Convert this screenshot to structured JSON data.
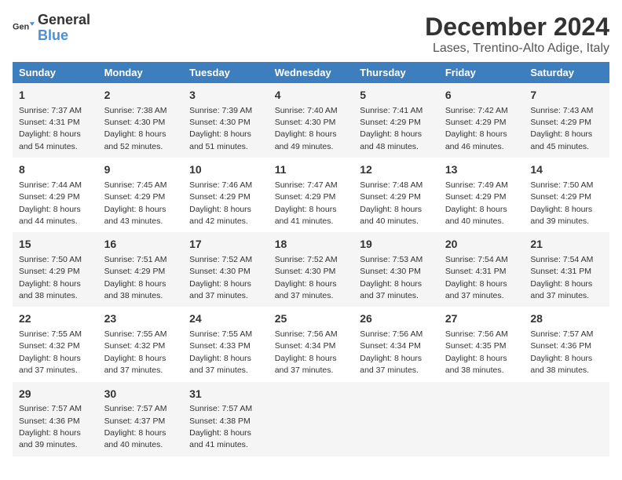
{
  "logo": {
    "text_general": "General",
    "text_blue": "Blue"
  },
  "title": "December 2024",
  "subtitle": "Lases, Trentino-Alto Adige, Italy",
  "days_of_week": [
    "Sunday",
    "Monday",
    "Tuesday",
    "Wednesday",
    "Thursday",
    "Friday",
    "Saturday"
  ],
  "weeks": [
    [
      {
        "day": "1",
        "sunrise": "7:37 AM",
        "sunset": "4:31 PM",
        "daylight": "8 hours and 54 minutes."
      },
      {
        "day": "2",
        "sunrise": "7:38 AM",
        "sunset": "4:30 PM",
        "daylight": "8 hours and 52 minutes."
      },
      {
        "day": "3",
        "sunrise": "7:39 AM",
        "sunset": "4:30 PM",
        "daylight": "8 hours and 51 minutes."
      },
      {
        "day": "4",
        "sunrise": "7:40 AM",
        "sunset": "4:30 PM",
        "daylight": "8 hours and 49 minutes."
      },
      {
        "day": "5",
        "sunrise": "7:41 AM",
        "sunset": "4:29 PM",
        "daylight": "8 hours and 48 minutes."
      },
      {
        "day": "6",
        "sunrise": "7:42 AM",
        "sunset": "4:29 PM",
        "daylight": "8 hours and 46 minutes."
      },
      {
        "day": "7",
        "sunrise": "7:43 AM",
        "sunset": "4:29 PM",
        "daylight": "8 hours and 45 minutes."
      }
    ],
    [
      {
        "day": "8",
        "sunrise": "7:44 AM",
        "sunset": "4:29 PM",
        "daylight": "8 hours and 44 minutes."
      },
      {
        "day": "9",
        "sunrise": "7:45 AM",
        "sunset": "4:29 PM",
        "daylight": "8 hours and 43 minutes."
      },
      {
        "day": "10",
        "sunrise": "7:46 AM",
        "sunset": "4:29 PM",
        "daylight": "8 hours and 42 minutes."
      },
      {
        "day": "11",
        "sunrise": "7:47 AM",
        "sunset": "4:29 PM",
        "daylight": "8 hours and 41 minutes."
      },
      {
        "day": "12",
        "sunrise": "7:48 AM",
        "sunset": "4:29 PM",
        "daylight": "8 hours and 40 minutes."
      },
      {
        "day": "13",
        "sunrise": "7:49 AM",
        "sunset": "4:29 PM",
        "daylight": "8 hours and 40 minutes."
      },
      {
        "day": "14",
        "sunrise": "7:50 AM",
        "sunset": "4:29 PM",
        "daylight": "8 hours and 39 minutes."
      }
    ],
    [
      {
        "day": "15",
        "sunrise": "7:50 AM",
        "sunset": "4:29 PM",
        "daylight": "8 hours and 38 minutes."
      },
      {
        "day": "16",
        "sunrise": "7:51 AM",
        "sunset": "4:29 PM",
        "daylight": "8 hours and 38 minutes."
      },
      {
        "day": "17",
        "sunrise": "7:52 AM",
        "sunset": "4:30 PM",
        "daylight": "8 hours and 37 minutes."
      },
      {
        "day": "18",
        "sunrise": "7:52 AM",
        "sunset": "4:30 PM",
        "daylight": "8 hours and 37 minutes."
      },
      {
        "day": "19",
        "sunrise": "7:53 AM",
        "sunset": "4:30 PM",
        "daylight": "8 hours and 37 minutes."
      },
      {
        "day": "20",
        "sunrise": "7:54 AM",
        "sunset": "4:31 PM",
        "daylight": "8 hours and 37 minutes."
      },
      {
        "day": "21",
        "sunrise": "7:54 AM",
        "sunset": "4:31 PM",
        "daylight": "8 hours and 37 minutes."
      }
    ],
    [
      {
        "day": "22",
        "sunrise": "7:55 AM",
        "sunset": "4:32 PM",
        "daylight": "8 hours and 37 minutes."
      },
      {
        "day": "23",
        "sunrise": "7:55 AM",
        "sunset": "4:32 PM",
        "daylight": "8 hours and 37 minutes."
      },
      {
        "day": "24",
        "sunrise": "7:55 AM",
        "sunset": "4:33 PM",
        "daylight": "8 hours and 37 minutes."
      },
      {
        "day": "25",
        "sunrise": "7:56 AM",
        "sunset": "4:34 PM",
        "daylight": "8 hours and 37 minutes."
      },
      {
        "day": "26",
        "sunrise": "7:56 AM",
        "sunset": "4:34 PM",
        "daylight": "8 hours and 37 minutes."
      },
      {
        "day": "27",
        "sunrise": "7:56 AM",
        "sunset": "4:35 PM",
        "daylight": "8 hours and 38 minutes."
      },
      {
        "day": "28",
        "sunrise": "7:57 AM",
        "sunset": "4:36 PM",
        "daylight": "8 hours and 38 minutes."
      }
    ],
    [
      {
        "day": "29",
        "sunrise": "7:57 AM",
        "sunset": "4:36 PM",
        "daylight": "8 hours and 39 minutes."
      },
      {
        "day": "30",
        "sunrise": "7:57 AM",
        "sunset": "4:37 PM",
        "daylight": "8 hours and 40 minutes."
      },
      {
        "day": "31",
        "sunrise": "7:57 AM",
        "sunset": "4:38 PM",
        "daylight": "8 hours and 41 minutes."
      },
      null,
      null,
      null,
      null
    ]
  ],
  "accent_color": "#3d7ebf"
}
